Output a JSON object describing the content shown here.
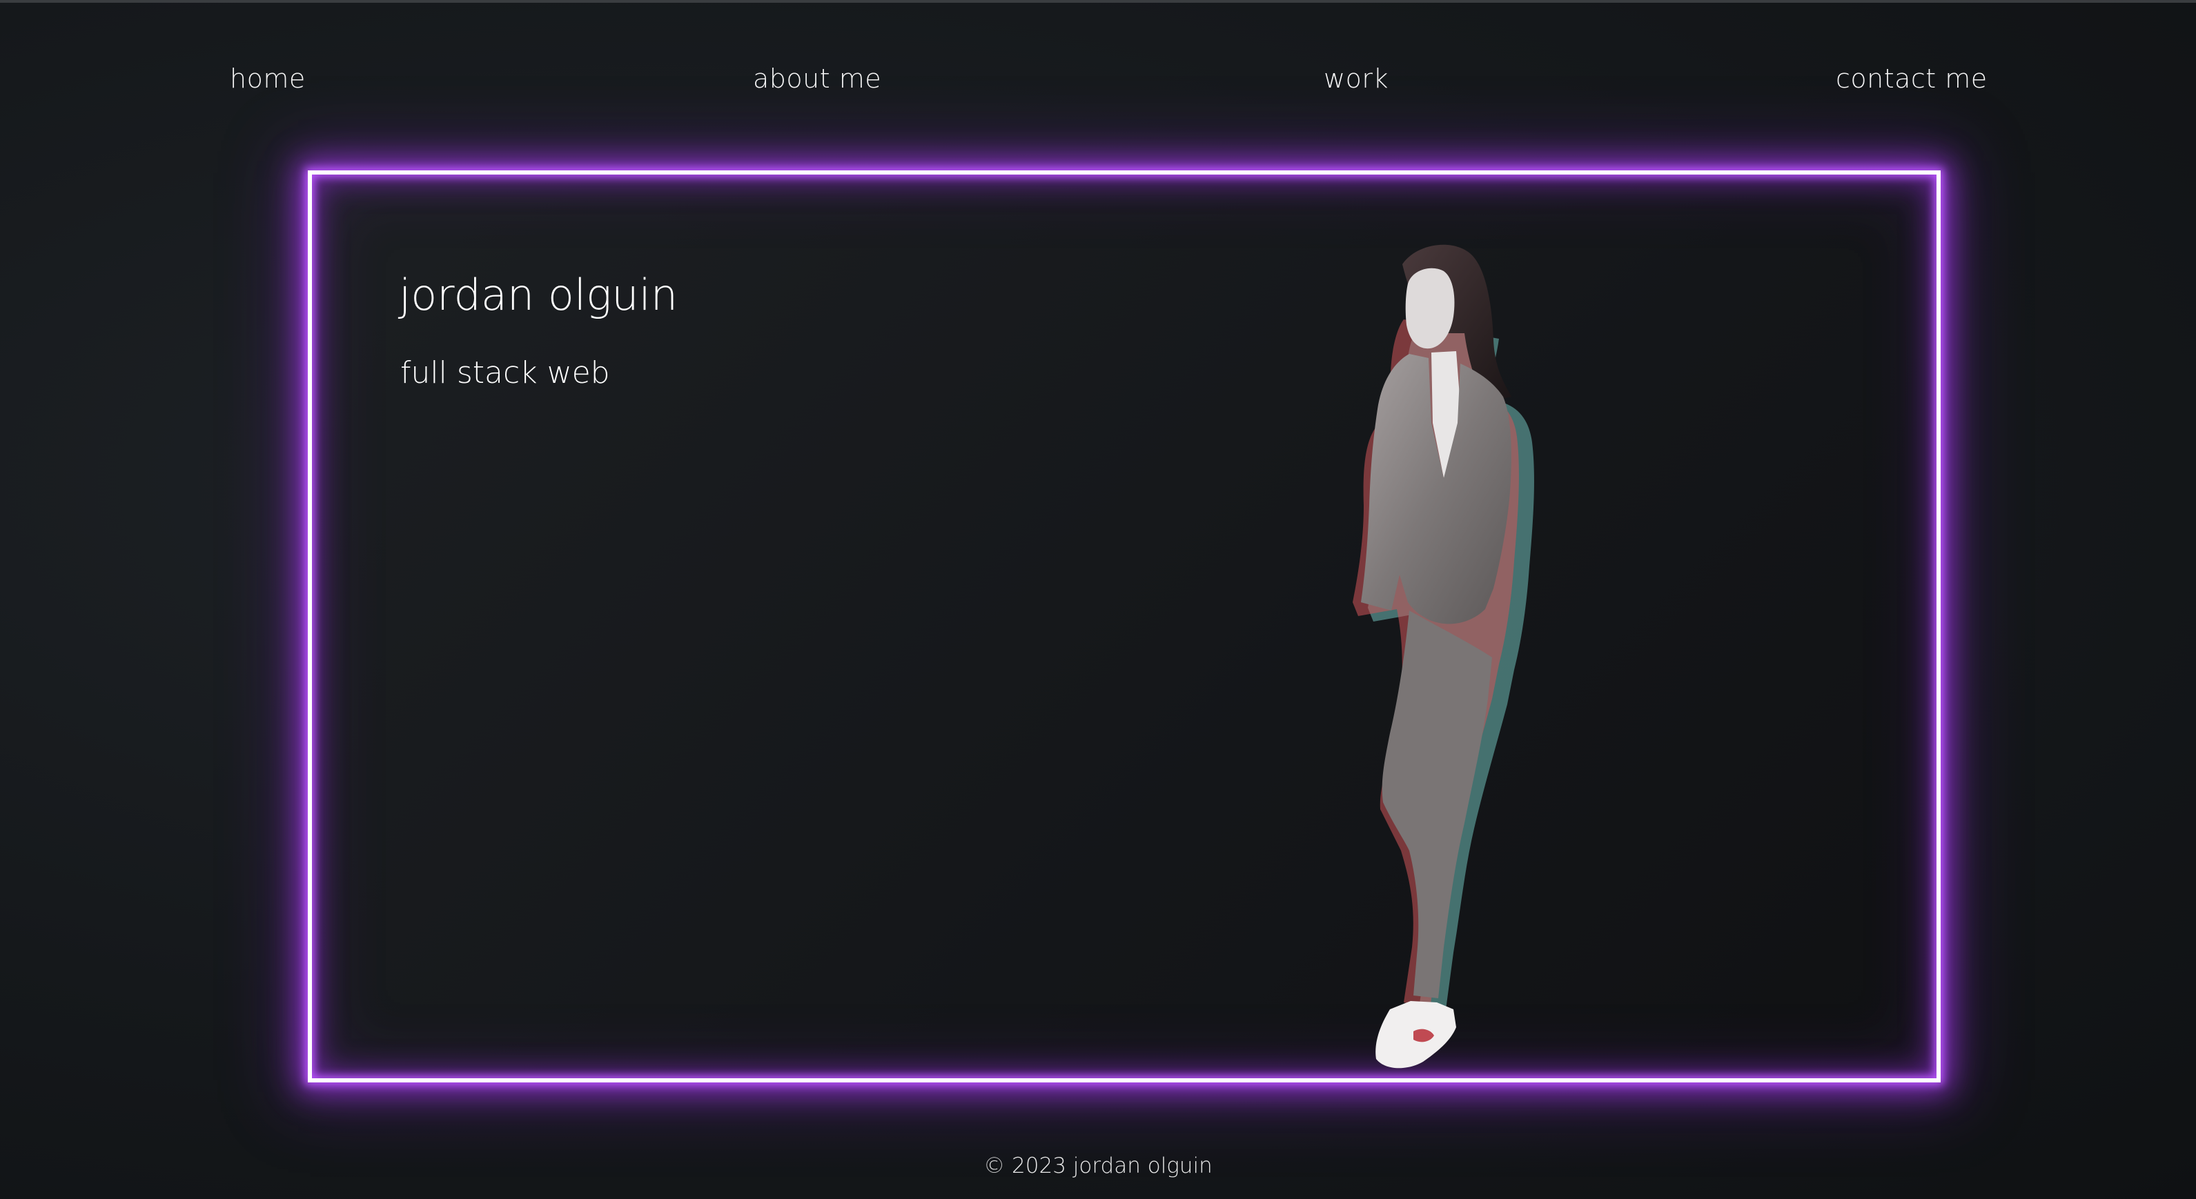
{
  "nav": {
    "items": [
      {
        "label": "home"
      },
      {
        "label": "about me"
      },
      {
        "label": "work"
      },
      {
        "label": "contact me"
      }
    ]
  },
  "hero": {
    "title": "jordan olguin",
    "subtitle": "full stack web",
    "frame_glow_color": "#b84dff",
    "frame_border_color": "#ffffff",
    "image": "portrait-photo"
  },
  "footer": {
    "copyright": "© 2023 jordan olguin"
  },
  "colors": {
    "background": "#141619",
    "text": "#f2f2f2",
    "accent": "#a33cf0"
  }
}
